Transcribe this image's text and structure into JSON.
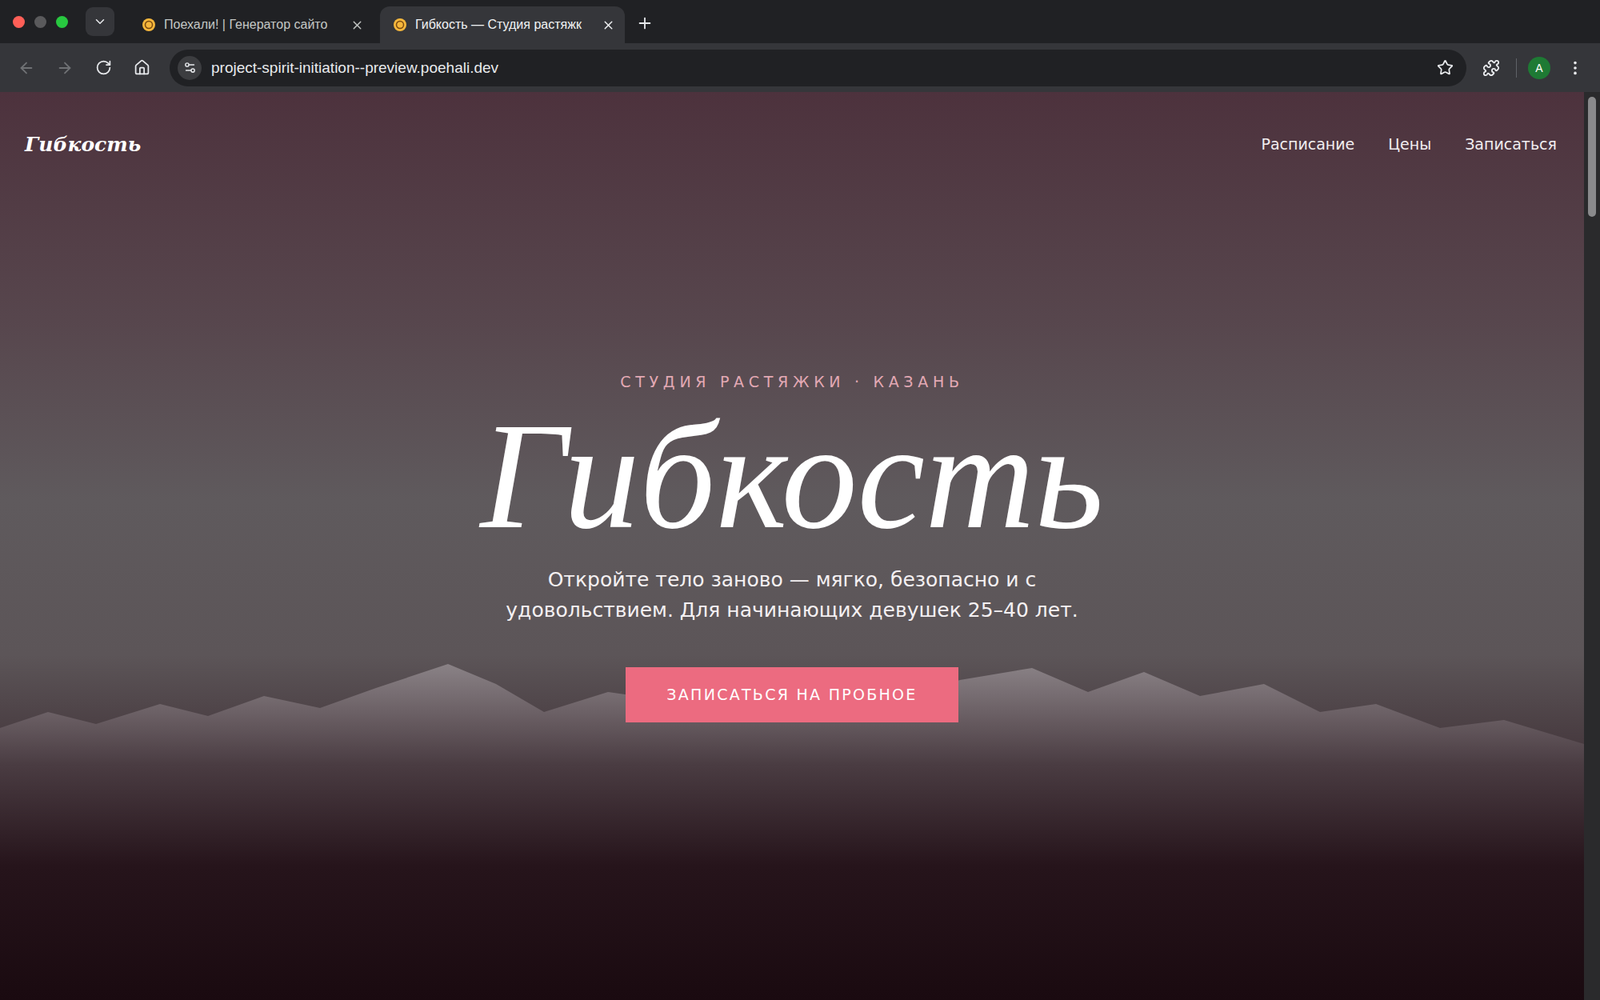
{
  "browser": {
    "tabs": [
      {
        "title": "Поехали! | Генератор сайто",
        "selected": false
      },
      {
        "title": "Гибкость — Студия растяжк",
        "selected": true
      }
    ],
    "nav": {
      "back_enabled": false,
      "forward_enabled": false
    },
    "address": "project-spirit-initiation--preview.poehali.dev",
    "bookmarked": false,
    "profile": "A"
  },
  "site": {
    "logo": "Гибкость",
    "nav": [
      "Расписание",
      "Цены",
      "Записаться"
    ],
    "hero": {
      "eyebrow": "СТУДИЯ РАСТЯЖКИ · КАЗАНЬ",
      "title": "Гибкость",
      "subtitle": "Откройте тело заново — мягко, безопасно и с удовольствием. Для начинающих девушек 25–40 лет.",
      "button": "ЗАПИСАТЬСЯ НА ПРОБНОЕ"
    }
  }
}
